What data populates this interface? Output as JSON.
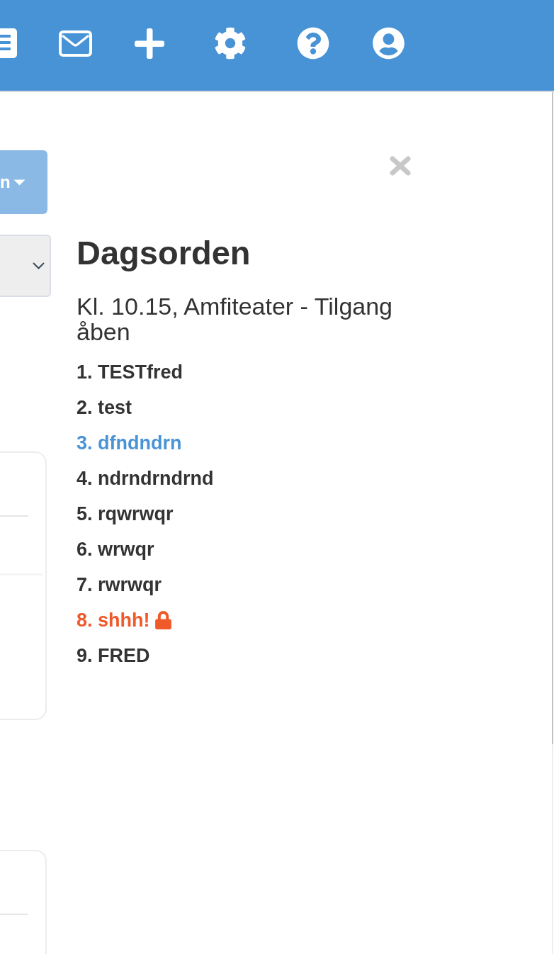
{
  "sidebar": {
    "dropdown_button": {
      "label": "n"
    }
  },
  "agenda": {
    "title": "Dagsorden",
    "subtitle": "Kl. 10.15, Amfiteater - Tilgang åben",
    "items": [
      {
        "text": "1. TESTfred",
        "color": "#333333",
        "locked": false
      },
      {
        "text": "2. test",
        "color": "#333333",
        "locked": false
      },
      {
        "text": "3. dfndndrn",
        "color": "#4a93d6",
        "locked": false
      },
      {
        "text": "4. ndrndrndrnd",
        "color": "#333333",
        "locked": false
      },
      {
        "text": "5. rqwrwqr",
        "color": "#333333",
        "locked": false
      },
      {
        "text": "6. wrwqr",
        "color": "#333333",
        "locked": false
      },
      {
        "text": "7. rwrwqr",
        "color": "#333333",
        "locked": false
      },
      {
        "text": "8. shhh!",
        "color": "#f05a2b",
        "locked": true
      },
      {
        "text": "9. FRED",
        "color": "#333333",
        "locked": false
      }
    ]
  }
}
